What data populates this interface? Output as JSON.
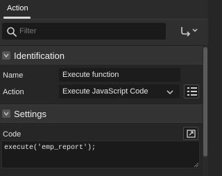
{
  "tab": {
    "label": "Action"
  },
  "filter": {
    "placeholder": "Filter",
    "value": ""
  },
  "sections": {
    "identification": {
      "title": "Identification",
      "name_label": "Name",
      "name_value": "Execute function",
      "action_label": "Action",
      "action_value": "Execute JavaScript Code"
    },
    "settings": {
      "title": "Settings",
      "code_label": "Code",
      "code_value": "execute('emp_report');"
    }
  },
  "icons": {
    "search": "search-icon",
    "goto": "goto-group-icon",
    "list": "list-icon",
    "expand": "expand-icon",
    "chevron": "chevron-down-icon"
  }
}
